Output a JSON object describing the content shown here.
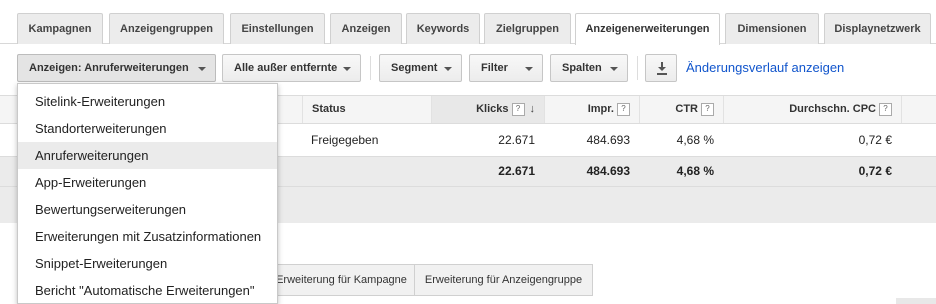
{
  "tabs": [
    "Kampagnen",
    "Anzeigengruppen",
    "Einstellungen",
    "Anzeigen",
    "Keywords",
    "Zielgruppen",
    "Anzeigenerweiterungen",
    "Dimensionen",
    "Displaynetzwerk"
  ],
  "active_tab": "Anzeigenerweiterungen",
  "toolbar": {
    "view_button": "Anzeigen: Anruferweiterungen",
    "filter_status": "Alle außer entfernte",
    "segment": "Segment",
    "filter": "Filter",
    "columns": "Spalten",
    "download_icon": "download-icon",
    "history_link": "Änderungsverlauf anzeigen"
  },
  "dropdown": {
    "items": [
      "Sitelink-Erweiterungen",
      "Standorterweiterungen",
      "Anruferweiterungen",
      "App-Erweiterungen",
      "Bewertungserweiterungen",
      "Erweiterungen mit Zusatzinformationen",
      "Snippet-Erweiterungen",
      "Bericht \"Automatische Erweiterungen\""
    ],
    "selected": "Anruferweiterungen"
  },
  "table": {
    "headers": {
      "status": "Status",
      "clicks": "Klicks",
      "impr": "Impr.",
      "ctr": "CTR",
      "cpc": "Durchschn. CPC"
    },
    "help_mark": "?",
    "sort_icon": "sort-descending-icon",
    "rows": [
      {
        "status": "Freigegeben",
        "clicks": "22.671",
        "impr": "484.693",
        "ctr": "4,68 %",
        "cpc": "0,72 €"
      }
    ],
    "total": {
      "clicks": "22.671",
      "impr": "484.693",
      "ctr": "4,68 %",
      "cpc": "0,72 €"
    }
  },
  "subtabs": [
    "Erweiterung für Kampagne",
    "Erweiterung für Anzeigengruppe"
  ],
  "colors": {
    "link": "#1155cc",
    "accent_red": "#d23f31",
    "selected_row": "#ebebeb"
  }
}
